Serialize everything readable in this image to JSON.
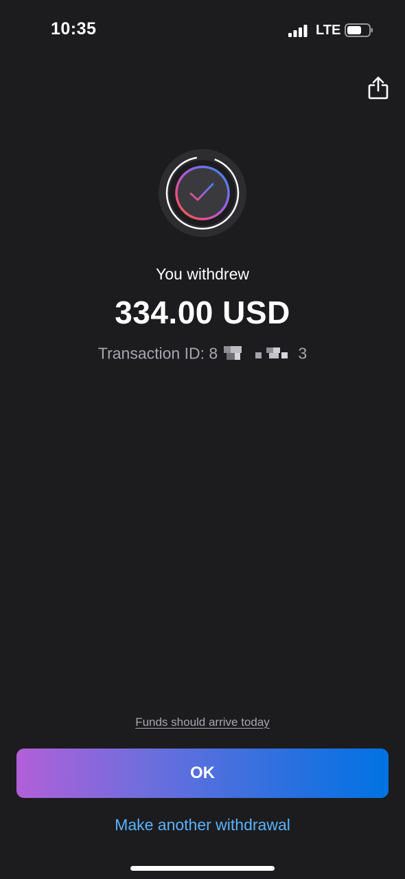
{
  "status_bar": {
    "time": "10:35",
    "network": "LTE",
    "icons": [
      "signal-icon",
      "battery-icon"
    ]
  },
  "header": {
    "share_icon": "share-icon"
  },
  "result": {
    "icon": "success-check-icon",
    "headline": "You withdrew",
    "amount": "334.00 USD",
    "transaction_label": "Transaction ID:",
    "transaction_id_start": "8",
    "transaction_id_end": "3"
  },
  "footer": {
    "funds_note": "Funds should arrive today",
    "ok_label": "OK",
    "another_label": "Make another withdrawal"
  },
  "colors": {
    "background": "#1c1c1e",
    "link": "#5ab3ff",
    "muted_text": "#a7a7ad",
    "button_gradient_start": "#b25fd8",
    "button_gradient_end": "#0072e3"
  }
}
